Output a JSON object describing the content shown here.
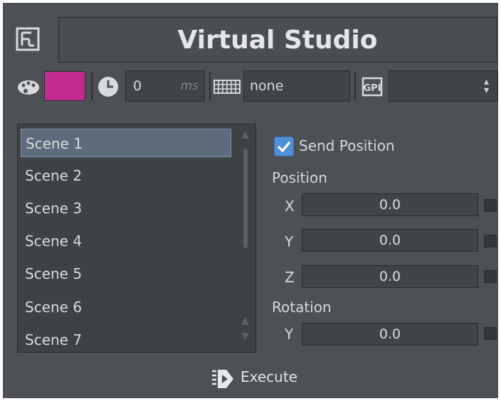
{
  "header": {
    "title": "Virtual Studio"
  },
  "toolbar": {
    "delay_value": "0",
    "delay_unit": "ms",
    "key_value": "none",
    "gpi_label": "GPI",
    "gpi_selected": "",
    "color_value": "#c32a8f"
  },
  "scenes": {
    "items": [
      "Scene 1",
      "Scene 2",
      "Scene 3",
      "Scene 4",
      "Scene 5",
      "Scene 6",
      "Scene 7"
    ],
    "selected": "Scene 1"
  },
  "settings": {
    "send_position_label": "Send Position",
    "send_position_checked": true,
    "position_heading": "Position",
    "position": {
      "x_label": "X",
      "x": "0.0",
      "y_label": "Y",
      "y": "0.0",
      "z_label": "Z",
      "z": "0.0"
    },
    "rotation_heading": "Rotation",
    "rotation": {
      "y_label": "Y",
      "y": "0.0"
    }
  },
  "footer": {
    "execute_label": "Execute"
  }
}
